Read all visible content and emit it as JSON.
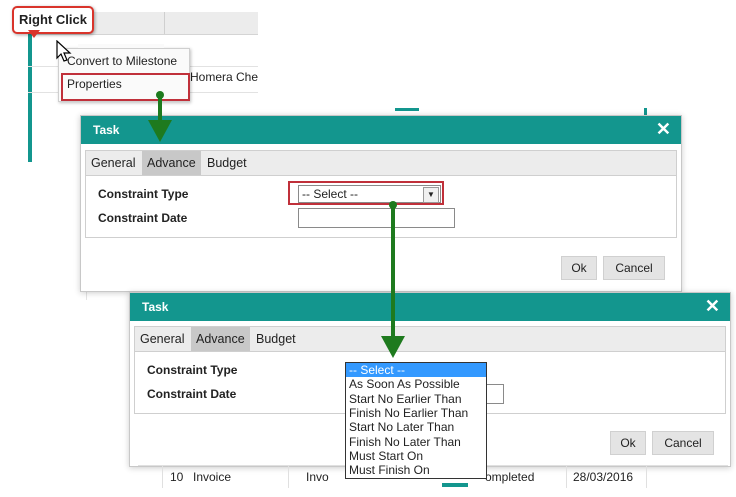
{
  "callout": {
    "label": "Right Click"
  },
  "background": {
    "task_name_partial": "Homera Che",
    "row_text_partial": "Homera Che"
  },
  "context_menu": {
    "items": [
      {
        "label": "Convert to Milestone"
      },
      {
        "label": "Properties"
      }
    ]
  },
  "dialog1": {
    "title": "Task",
    "close_glyph": "✕",
    "tabs": [
      {
        "label": "General"
      },
      {
        "label": "Advance"
      },
      {
        "label": "Budget"
      }
    ],
    "active_tab": "Advance",
    "constraint_type_label": "Constraint Type",
    "constraint_date_label": "Constraint Date",
    "select_value": "-- Select --",
    "ok_label": "Ok",
    "cancel_label": "Cancel"
  },
  "dialog2": {
    "title": "Task",
    "close_glyph": "✕",
    "tabs": [
      {
        "label": "General"
      },
      {
        "label": "Advance"
      },
      {
        "label": "Budget"
      }
    ],
    "active_tab": "Advance",
    "constraint_type_label": "Constraint Type",
    "constraint_date_label": "Constraint Date",
    "ok_label": "Ok",
    "cancel_label": "Cancel",
    "dropdown_options": [
      "-- Select --",
      "As Soon As Possible",
      "Start No Earlier Than",
      "Finish No Earlier Than",
      "Start No Later Than",
      "Finish No Later Than",
      "Must Start On",
      "Must Finish On"
    ],
    "selected_option": "-- Select --"
  },
  "bottom_row": {
    "id": "10",
    "name": "Invoice",
    "type_partial": "Invo",
    "status_partial": "ompleted",
    "date": "28/03/2016"
  },
  "colors": {
    "accent": "#13968e",
    "highlight": "#c0303a",
    "arrow": "#1e7a1e",
    "dropdown_selected": "#3399ff"
  }
}
